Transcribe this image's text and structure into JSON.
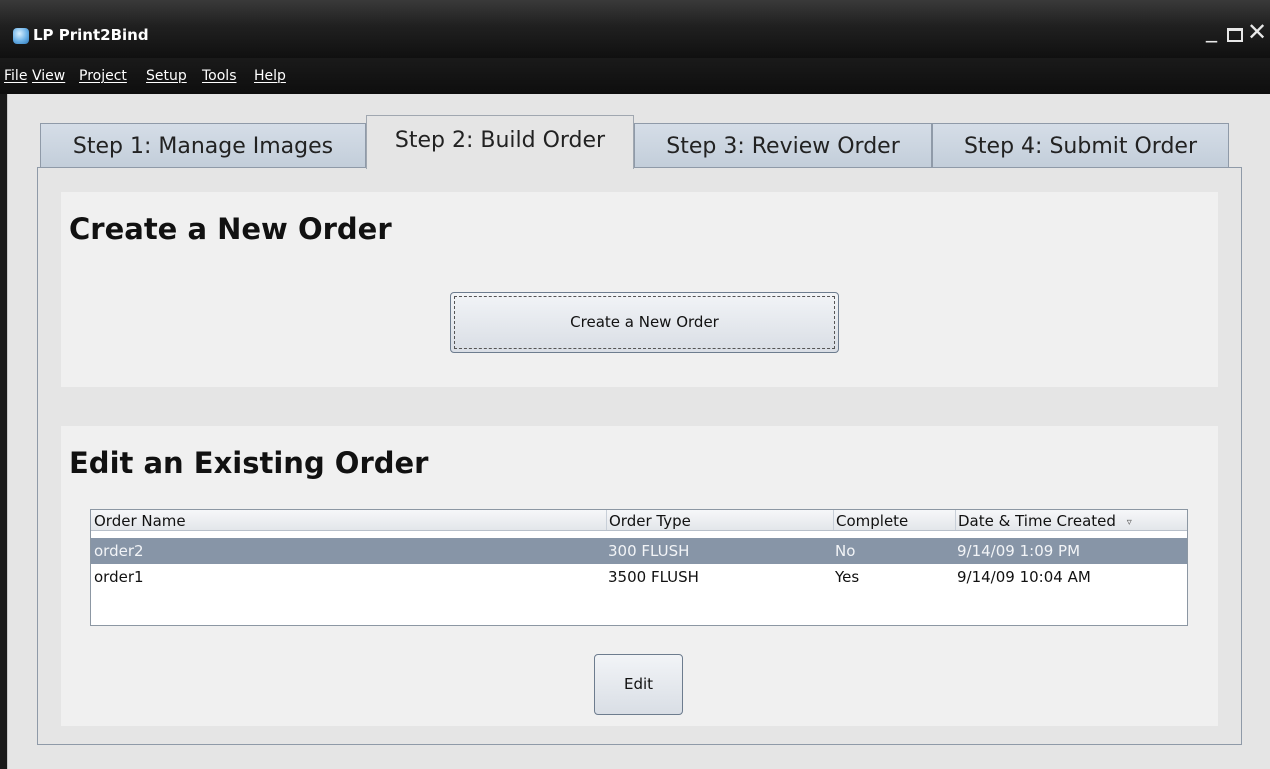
{
  "window": {
    "title": "LP Print2Bind",
    "controls": {
      "minimize": "_",
      "maximize": "",
      "close": "✕"
    }
  },
  "menu": {
    "file": "File",
    "view": "View",
    "project": "Project",
    "setup": "Setup",
    "tools": "Tools",
    "help": "Help"
  },
  "tabs": [
    {
      "label": "Step 1: Manage Images",
      "selected": false
    },
    {
      "label": "Step 2: Build Order",
      "selected": true
    },
    {
      "label": "Step 3: Review Order",
      "selected": false
    },
    {
      "label": "Step 4: Submit Order",
      "selected": false
    }
  ],
  "create_section": {
    "title": "Create a New Order",
    "button_label": "Create a New Order"
  },
  "edit_section": {
    "title": "Edit an Existing Order",
    "table": {
      "headers": [
        "Order Name",
        "Order Type",
        "Complete",
        "Date & Time Created"
      ],
      "sort_icon": "▿",
      "rows": [
        [
          "order2",
          "300 FLUSH",
          "No",
          "9/14/09 1:09 PM"
        ],
        [
          "order1",
          "3500 FLUSH",
          "Yes",
          "9/14/09 10:04 AM"
        ]
      ],
      "selected_row": 0
    },
    "button_label": "Edit"
  },
  "colors": {
    "titlebar": "#202020",
    "selected_row": "#8795a7",
    "tab_inactive": "#c9d3de"
  }
}
